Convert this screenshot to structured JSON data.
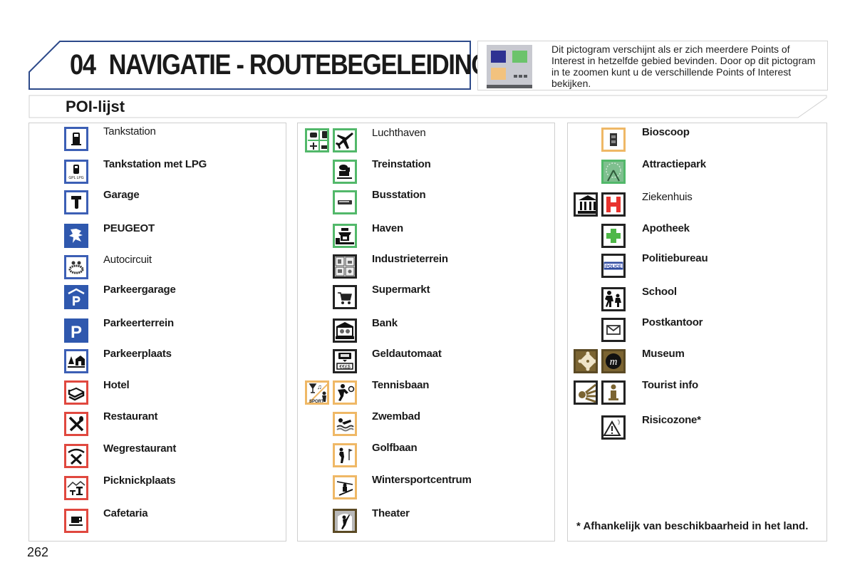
{
  "header": {
    "chapter_number": "04",
    "chapter_title": "NAVIGATIE - ROUTEBEGELEIDING",
    "info_icon": "multiple-poi-icon",
    "info_colors": [
      "#2e3192",
      "#6cc36b",
      "#f2c27e"
    ],
    "info_text": "Dit pictogram verschijnt als er zich meerdere Points of Interest in hetzelfde gebied bevinden. Door op dit pictogram in te zoomen kunt u de verschillende Points of Interest bekijken."
  },
  "section": {
    "title": "POI-lijst"
  },
  "columns": [
    {
      "items": [
        {
          "label": "Tankstation",
          "icon": "fuel-pump-icon",
          "color": "blue",
          "bold": false
        },
        {
          "label": "Tankstation met LPG",
          "icon": "lpg-fuel-pump-icon",
          "color": "blue",
          "bold": true
        },
        {
          "label": "Garage",
          "icon": "wrench-icon",
          "color": "blue",
          "bold": true
        },
        {
          "label": "PEUGEOT",
          "icon": "peugeot-lion-icon",
          "color": "blue",
          "bold": true
        },
        {
          "label": "Autocircuit",
          "icon": "race-circuit-icon",
          "color": "blue",
          "bold": false
        },
        {
          "label": "Parkeergarage",
          "icon": "parking-garage-icon",
          "color": "blue",
          "bold": true
        },
        {
          "label": "Parkeerterrein",
          "icon": "parking-icon",
          "color": "blue",
          "bold": true
        },
        {
          "label": "Parkeerplaats",
          "icon": "rest-area-icon",
          "color": "blue",
          "bold": true
        },
        {
          "label": "Hotel",
          "icon": "bed-icon",
          "color": "red",
          "bold": true
        },
        {
          "label": "Restaurant",
          "icon": "fork-knife-icon",
          "color": "red",
          "bold": true
        },
        {
          "label": "Wegrestaurant",
          "icon": "roadside-restaurant-icon",
          "color": "red",
          "bold": true
        },
        {
          "label": "Picknickplaats",
          "icon": "picnic-icon",
          "color": "red",
          "bold": true
        },
        {
          "label": "Cafetaria",
          "icon": "coffee-cup-icon",
          "color": "red",
          "bold": true
        }
      ]
    },
    {
      "items": [
        {
          "label": "Luchthaven",
          "icon": "airplane-icon",
          "group_icon": "transport-group-icon",
          "color": "green",
          "bold": false
        },
        {
          "label": "Treinstation",
          "icon": "train-icon",
          "color": "green",
          "bold": true
        },
        {
          "label": "Busstation",
          "icon": "bus-icon",
          "color": "green",
          "bold": true
        },
        {
          "label": "Haven",
          "icon": "ferry-icon",
          "color": "green",
          "bold": true
        },
        {
          "label": "Industrieterrein",
          "icon": "industry-icon",
          "color": "black",
          "bold": true
        },
        {
          "label": "Supermarkt",
          "icon": "shopping-cart-icon",
          "color": "black",
          "bold": true
        },
        {
          "label": "Bank",
          "icon": "bank-icon",
          "color": "black",
          "bold": true
        },
        {
          "label": "Geldautomaat",
          "icon": "atm-icon",
          "color": "black",
          "bold": true
        },
        {
          "label": "Tennisbaan",
          "icon": "tennis-icon",
          "group_icon": "sport-leisure-group-icon",
          "color": "orange",
          "bold": true
        },
        {
          "label": "Zwembad",
          "icon": "swimming-icon",
          "color": "orange",
          "bold": true
        },
        {
          "label": "Golfbaan",
          "icon": "golf-icon",
          "color": "orange",
          "bold": true
        },
        {
          "label": "Wintersportcentrum",
          "icon": "ski-lift-icon",
          "color": "orange",
          "bold": true
        },
        {
          "label": "Theater",
          "icon": "theater-icon",
          "color": "brown",
          "bold": true
        }
      ]
    },
    {
      "items": [
        {
          "label": "Bioscoop",
          "icon": "film-icon",
          "color": "orange",
          "bold": true
        },
        {
          "label": "Attractiepark",
          "icon": "ferris-wheel-icon",
          "color": "green",
          "bold": true
        },
        {
          "label": "Ziekenhuis",
          "icon": "hospital-icon",
          "group_icon": "public-building-group-icon",
          "color": "black",
          "bold": false
        },
        {
          "label": "Apotheek",
          "icon": "pharmacy-cross-icon",
          "color": "black",
          "bold": true
        },
        {
          "label": "Politiebureau",
          "icon": "police-icon",
          "color": "black",
          "bold": true
        },
        {
          "label": "School",
          "icon": "school-children-icon",
          "color": "black",
          "bold": true
        },
        {
          "label": "Postkantoor",
          "icon": "envelope-icon",
          "color": "black",
          "bold": true
        },
        {
          "label": "Museum",
          "icon": "museum-icon",
          "group_icon": "culture-group-icon",
          "color": "brown",
          "bold": true
        },
        {
          "label": "Tourist info",
          "icon": "info-icon",
          "group_icon": "sightseeing-group-icon",
          "color": "black",
          "bold": true
        },
        {
          "label": "Risicozone*",
          "icon": "warning-triangle-icon",
          "color": "black",
          "bold": true
        }
      ],
      "footnote": "* Afhankelijk van beschikbaarheid in het land."
    }
  ],
  "page_number": "262"
}
